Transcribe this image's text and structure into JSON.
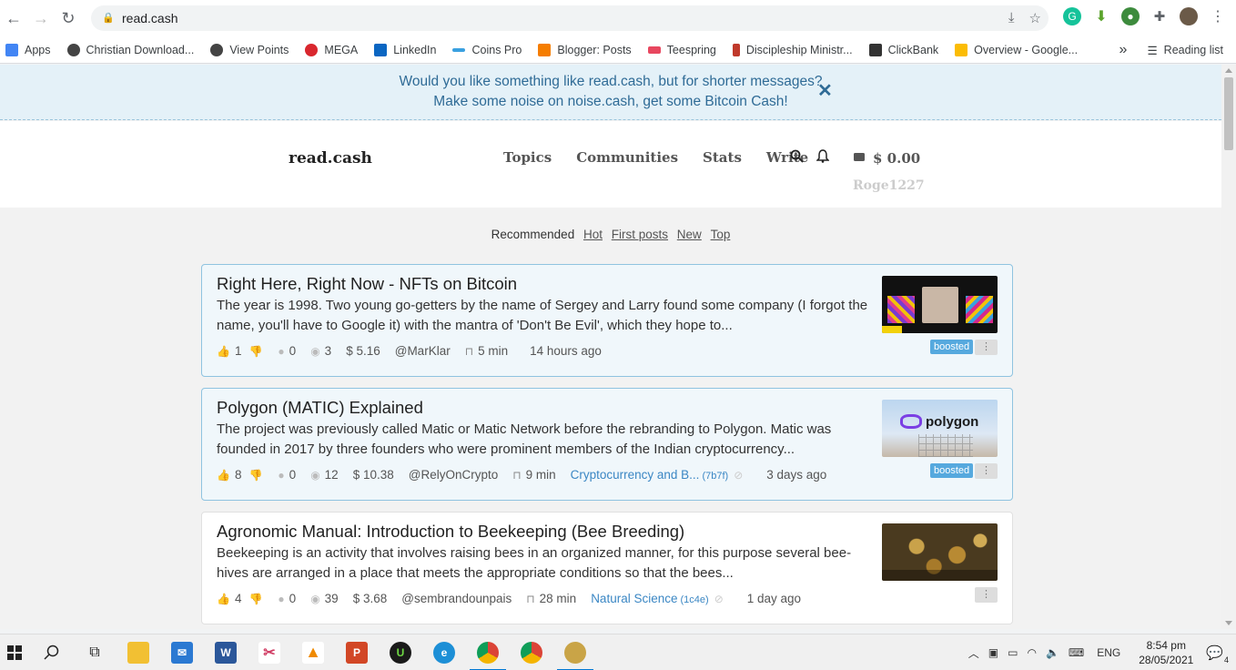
{
  "browser": {
    "url": "read.cash",
    "bookmarks": [
      {
        "label": "Apps",
        "color": "#4285f4"
      },
      {
        "label": "Christian Download...",
        "color": "#444444"
      },
      {
        "label": "View Points",
        "color": "#444444"
      },
      {
        "label": "MEGA",
        "color": "#d9272e"
      },
      {
        "label": "LinkedIn",
        "color": "#0a66c2"
      },
      {
        "label": "Coins Pro",
        "color": "#3aa0e0"
      },
      {
        "label": "Blogger: Posts",
        "color": "#f57d00"
      },
      {
        "label": "Teespring",
        "color": "#e8475f"
      },
      {
        "label": "Discipleship Ministr...",
        "color": "#c0392b"
      },
      {
        "label": "ClickBank",
        "color": "#333333"
      },
      {
        "label": "Overview - Google...",
        "color": "#fbbc04"
      }
    ],
    "more_bookmarks": "»",
    "reading_list": "Reading list"
  },
  "banner": {
    "line1": "Would you like something like read.cash, but for shorter messages?",
    "line2": "Make some noise on noise.cash, get some Bitcoin Cash!",
    "close": "✕"
  },
  "header": {
    "logo": "read.cash",
    "menu": [
      "Topics",
      "Communities",
      "Stats",
      "Write"
    ],
    "balance": "$ 0.00",
    "username": "Roge1227"
  },
  "sort": {
    "active": "Recommended",
    "links": [
      "Hot",
      "First posts",
      "New",
      "Top"
    ]
  },
  "articles": [
    {
      "title": "Right Here, Right Now - NFTs on Bitcoin",
      "excerpt": "The year is 1998. Two young go-getters by the name of Sergey and Larry found some company (I forgot the name, you'll have to Google it) with the mantra of 'Don't Be Evil', which they hope to...",
      "likes": "1",
      "comments": "0",
      "views": "3",
      "earned": "$ 5.16",
      "author": "@MarKlar",
      "read_time": "5 min",
      "community": "",
      "community_id": "",
      "age": "14 hours ago",
      "badge": "boosted",
      "more": "⋮"
    },
    {
      "title": "Polygon (MATIC) Explained",
      "excerpt": "The project was previously called Matic or Matic Network before the rebranding to Polygon. Matic was founded in 2017 by three founders who were prominent members of the Indian cryptocurrency...",
      "likes": "8",
      "comments": "0",
      "views": "12",
      "earned": "$ 10.38",
      "author": "@RelyOnCrypto",
      "read_time": "9 min",
      "community": "Cryptocurrency and B...",
      "community_id": "(7b7f)",
      "age": "3 days ago",
      "badge": "boosted",
      "more": "⋮",
      "thumb_text": "polygon"
    },
    {
      "title": "Agronomic Manual: Introduction to Beekeeping (Bee Breeding)",
      "excerpt": "Beekeeping is an activity that involves raising bees in an organized manner, for this purpose several bee-hives are arranged in a place that meets the appropriate conditions so that the bees...",
      "likes": "4",
      "comments": "0",
      "views": "39",
      "earned": "$ 3.68",
      "author": "@sembrandounpais",
      "read_time": "28 min",
      "community": "Natural Science",
      "community_id": "(1c4e)",
      "age": "1 day ago",
      "badge": "",
      "more": "⋮"
    }
  ],
  "taskbar": {
    "lang": "ENG",
    "time": "8:54 pm",
    "date": "28/05/2021",
    "notifications": "4"
  }
}
